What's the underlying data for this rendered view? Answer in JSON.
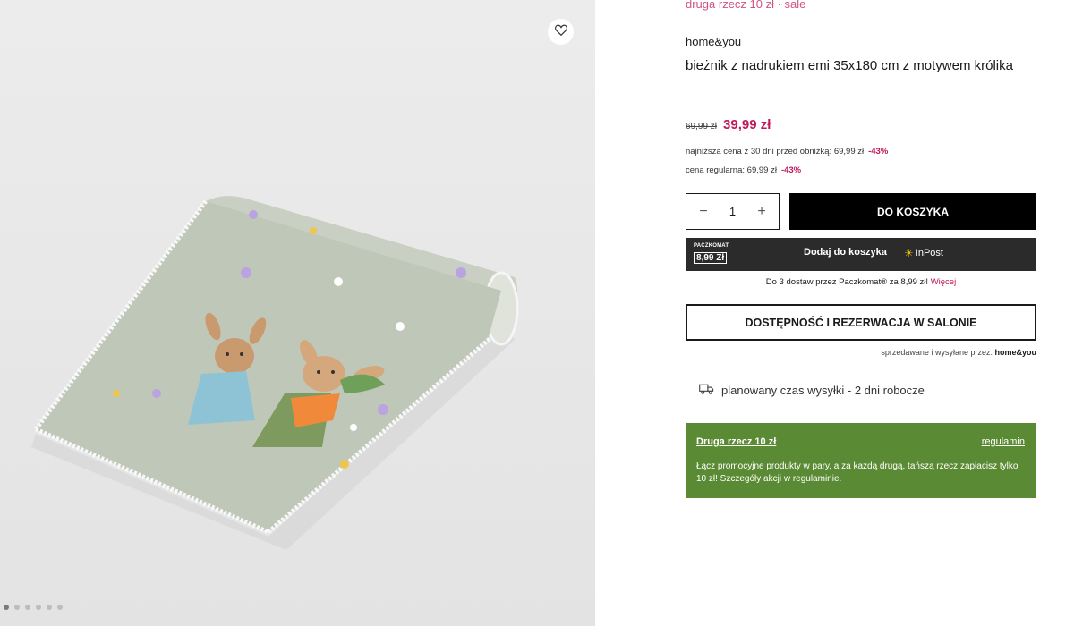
{
  "colors": {
    "accent": "#c2185b",
    "button_dark": "#000000",
    "inpost_bar": "#2b2b2b",
    "promo_green": "#5b8a34",
    "gallery_bg": "#e9e9e9"
  },
  "gallery": {
    "wishlist_icon": "heart-icon",
    "image_count": 6,
    "active_index": 0
  },
  "product": {
    "promo_top": "druga rzecz 10 zł · sale",
    "brand": "home&you",
    "title": "bieżnik z nadrukiem emi 35x180 cm z motywem królika",
    "old_price": "69,99 zł",
    "new_price": "39,99 zł",
    "lowest_price_label": "najniższa cena z 30 dni przed obniżką: 69,99 zł",
    "lowest_price_discount": "-43%",
    "regular_price_label": "cena regularna: 69,99 zł",
    "regular_price_discount": "-43%"
  },
  "purchase": {
    "quantity": "1",
    "minus_label": "−",
    "plus_label": "+",
    "add_to_cart": "DO KOSZYKA",
    "paczkomat_label": "PACZKOMAT",
    "paczkomat_price": "8,99 Zł",
    "inpost_button_text": "Dodaj do koszyka",
    "inpost_logo_text": "InPost",
    "delivery_note": "Do 3 dostaw przez Paczkomat® za 8,99 zł!",
    "delivery_more": "Więcej",
    "availability_button": "DOSTĘPNOŚĆ I REZERWACJA W SALONIE",
    "sold_by_label": "sprzedawane i wysyłane przez:",
    "sold_by_value": "home&you",
    "shipping_icon": "truck-icon",
    "shipping_text": "planowany czas wysyłki - 2 dni robocze"
  },
  "promo_box": {
    "title": "Druga rzecz 10 zł",
    "link": "regulamin",
    "text": "Łącz promocyjne produkty w pary, a za każdą drugą, tańszą rzecz zapłacisz tylko 10 zł! Szczegóły akcji w regulaminie."
  }
}
